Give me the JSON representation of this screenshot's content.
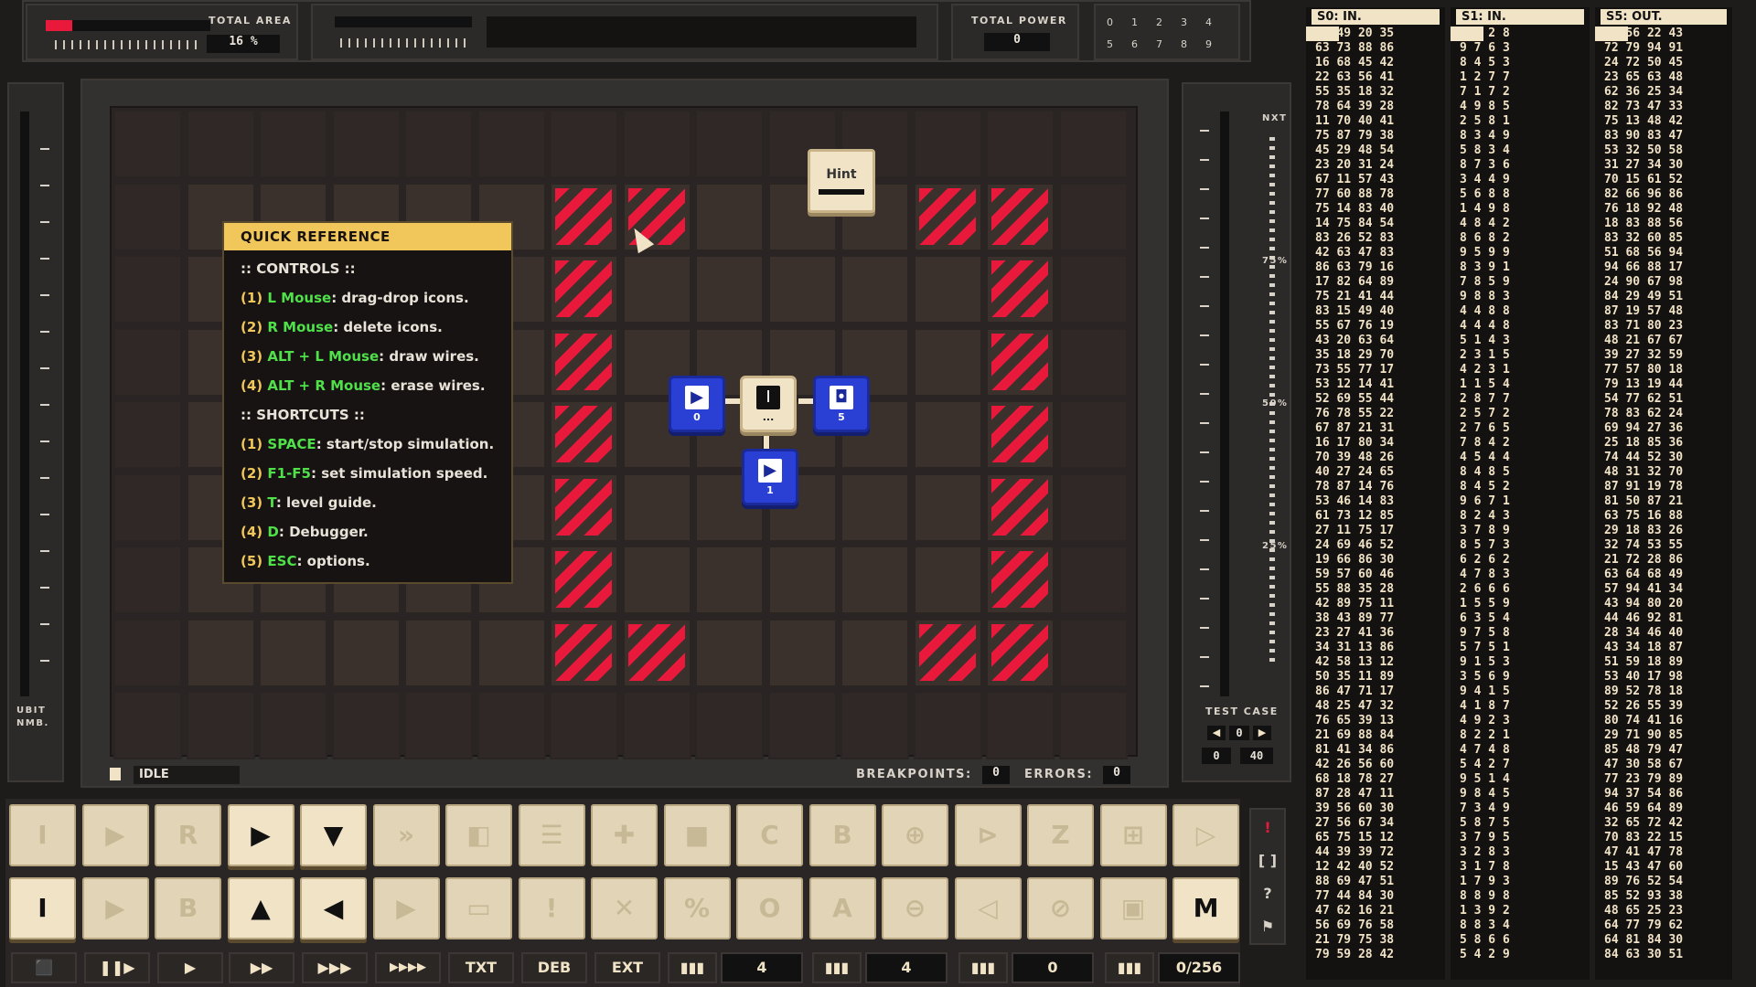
{
  "top_bar": {
    "total_area_label": "TOTAL AREA",
    "total_area_value": "16 %",
    "total_area_fraction": 0.16,
    "total_power_label": "TOTAL POWER",
    "total_power_value": "0",
    "digit_labels": [
      "0",
      "1",
      "2",
      "3",
      "4",
      "5",
      "6",
      "7",
      "8",
      "9"
    ]
  },
  "board": {
    "hint_label": "Hint",
    "blocks": [
      {
        "glyph": "▶",
        "number": "0"
      },
      {
        "glyph": "I",
        "number": "..."
      },
      {
        "glyph": "◘",
        "number": "5"
      },
      {
        "glyph": "▶",
        "number": "1"
      }
    ]
  },
  "quick_reference": {
    "title": "QUICK REFERENCE",
    "controls_header": ":: CONTROLS ::",
    "controls": [
      {
        "num": "(1)",
        "key": "L Mouse",
        "desc": ": drag-drop icons."
      },
      {
        "num": "(2)",
        "key": "R Mouse",
        "desc": ": delete icons."
      },
      {
        "num": "(3)",
        "key": "ALT + L Mouse",
        "desc": ": draw wires."
      },
      {
        "num": "(4)",
        "key": "ALT + R Mouse",
        "desc": ": erase wires."
      }
    ],
    "shortcuts_header": ":: SHORTCUTS ::",
    "shortcuts": [
      {
        "num": "(1)",
        "key": "SPACE",
        "desc": ": start/stop simulation."
      },
      {
        "num": "(2)",
        "key": "F1-F5",
        "desc": ": set simulation speed."
      },
      {
        "num": "(3)",
        "key": "T",
        "desc": ": level guide."
      },
      {
        "num": "(4)",
        "key": "D",
        "desc": ": Debugger."
      },
      {
        "num": "(5)",
        "key": "ESC",
        "desc": ": options."
      }
    ]
  },
  "status_bar": {
    "state": "IDLE",
    "breakpoints_label": "BREAKPOINTS:",
    "breakpoints_value": "0",
    "errors_label": "ERRORS:",
    "errors_value": "0"
  },
  "left_gauge": {
    "label_line1": "UBIT",
    "label_line2": "NMB."
  },
  "right_gauge": {
    "nxt_label": "NXT",
    "marks": [
      "75%",
      "50%",
      "25%"
    ],
    "test_case_label": "TEST CASE",
    "test_case_value": "0",
    "test_progress_current": "0",
    "test_progress_total": "40"
  },
  "io_columns": [
    {
      "title": "S0: IN.",
      "rows": [
        "60 49 20 35",
        "63 73 88 86",
        "16 68 45 42",
        "22 63 56 41",
        "55 35 18 32",
        "78 64 39 28",
        "11 70 40 41",
        "75 87 79 38",
        "45 29 48 54",
        "23 20 31 24",
        "67 11 57 43",
        "77 60 88 78",
        "75 14 83 40",
        "14 75 84 54",
        "83 26 52 83",
        "42 63 47 83",
        "86 63 79 16",
        "17 82 64 89",
        "75 21 41 44",
        "83 15 49 40",
        "55 67 76 19",
        "43 20 63 64",
        "35 18 29 70",
        "73 55 77 17",
        "53 12 14 41",
        "52 69 55 44",
        "76 78 55 22",
        "67 87 21 31",
        "16 17 80 34",
        "70 39 48 26",
        "40 27 24 65",
        "78 87 14 76",
        "53 46 14 83",
        "61 73 12 85",
        "27 11 75 17",
        "24 69 46 52",
        "19 66 86 30",
        "59 57 60 46",
        "55 88 35 28",
        "42 89 75 11",
        "38 43 89 77",
        "23 27 41 36",
        "34 31 13 86",
        "42 58 13 12",
        "50 35 11 89",
        "86 47 71 17",
        "48 25 47 32",
        "76 65 39 13",
        "21 69 88 84",
        "81 41 34 86",
        "42 26 56 60",
        "68 18 78 27",
        "87 28 47 11",
        "39 56 60 30",
        "27 56 67 34",
        "65 75 15 12",
        "44 39 39 72",
        "12 42 40 52",
        "88 69 47 51",
        "77 44 84 30",
        "47 62 16 21",
        "56 69 76 58",
        "21 79 75 38",
        "79 59 28 42"
      ]
    },
    {
      "title": "S1: IN.",
      "rows": [
        "7 7 2 8",
        "9 7 6 3",
        "8 4 5 3",
        "1 2 7 7",
        "7 1 7 2",
        "4 9 8 5",
        "2 5 8 1",
        "8 3 4 9",
        "5 8 3 4",
        "8 7 3 6",
        "3 4 4 9",
        "5 6 8 8",
        "1 4 9 8",
        "4 8 4 2",
        "8 6 8 2",
        "9 5 9 9",
        "8 3 9 1",
        "7 8 5 9",
        "9 8 8 3",
        "4 4 8 8",
        "4 4 4 8",
        "5 1 4 3",
        "2 3 1 5",
        "4 2 3 1",
        "1 1 5 4",
        "2 8 7 7",
        "2 5 7 2",
        "2 7 6 5",
        "7 8 4 2",
        "4 5 4 4",
        "8 4 8 5",
        "8 4 5 2",
        "9 6 7 1",
        "8 2 4 3",
        "3 7 8 9",
        "8 5 7 3",
        "6 2 6 2",
        "4 7 8 3",
        "2 6 6 6",
        "1 5 5 9",
        "6 3 5 4",
        "9 7 5 8",
        "5 7 5 1",
        "9 1 5 3",
        "3 5 6 9",
        "9 4 1 5",
        "4 1 8 7",
        "4 9 2 3",
        "8 2 2 1",
        "4 7 4 8",
        "5 4 2 7",
        "9 5 1 4",
        "9 8 4 5",
        "7 3 4 9",
        "5 8 7 5",
        "3 7 9 5",
        "3 2 8 3",
        "3 1 7 8",
        "1 7 9 3",
        "8 8 9 8",
        "1 3 9 2",
        "8 8 3 4",
        "5 8 6 6",
        "5 4 2 9"
      ]
    },
    {
      "title": "S5: OUT.",
      "rows": [
        "67 56 22 43",
        "72 79 94 91",
        "24 72 50 45",
        "23 65 63 48",
        "62 36 25 34",
        "82 73 47 33",
        "75 13 48 42",
        "83 90 83 47",
        "53 32 50 58",
        "31 27 34 30",
        "70 15 61 52",
        "82 66 96 86",
        "76 18 92 48",
        "18 83 88 56",
        "83 32 60 85",
        "51 68 56 94",
        "94 66 88 17",
        "24 90 67 98",
        "84 29 49 51",
        "87 19 57 48",
        "83 71 80 23",
        "48 21 67 67",
        "39 27 32 59",
        "77 57 80 18",
        "79 13 19 44",
        "54 77 62 51",
        "78 83 62 24",
        "69 94 27 36",
        "25 18 85 36",
        "74 44 52 30",
        "48 31 32 70",
        "87 91 19 78",
        "81 50 87 21",
        "63 75 16 88",
        "29 18 83 26",
        "32 74 53 55",
        "21 72 28 86",
        "63 64 68 49",
        "57 94 41 34",
        "43 94 80 20",
        "44 46 92 81",
        "28 34 46 40",
        "43 34 18 87",
        "51 59 18 89",
        "53 40 17 98",
        "89 52 78 18",
        "52 26 55 39",
        "80 74 41 16",
        "29 71 90 85",
        "85 48 79 47",
        "47 30 58 67",
        "77 23 79 89",
        "94 37 54 86",
        "46 59 64 89",
        "32 65 72 42",
        "70 83 22 15",
        "47 41 47 78",
        "15 43 47 60",
        "89 76 52 54",
        "85 52 93 38",
        "48 65 25 23",
        "64 77 79 62",
        "64 81 84 30",
        "84 63 30 51"
      ]
    }
  ],
  "palette": {
    "row1": [
      "I",
      "▶",
      "R",
      "▶",
      "▼",
      "»",
      "◧",
      "☰",
      "✚",
      "■",
      "C",
      "B",
      "⊕",
      "⊳",
      "Z",
      "⊞",
      "▷"
    ],
    "row2": [
      "I",
      "▶",
      "B",
      "▲",
      "◀",
      "▶",
      "▭",
      "!",
      "✕",
      "%",
      "O",
      "A",
      "⊖",
      "◁",
      "⊘",
      "▣",
      "M"
    ],
    "row1_active": [
      false,
      false,
      false,
      true,
      true,
      false,
      false,
      false,
      false,
      false,
      false,
      false,
      false,
      false,
      false,
      false,
      false
    ],
    "row2_active": [
      true,
      false,
      false,
      true,
      true,
      false,
      false,
      false,
      false,
      false,
      false,
      false,
      false,
      false,
      false,
      false,
      true
    ]
  },
  "side_tools": [
    "!",
    "[ ]",
    "?",
    "⚑"
  ],
  "bottom_controls": {
    "buttons": [
      "⬛",
      "❚❚▶",
      "▶",
      "▶▶",
      "▶▶▶",
      "▶▶▶▶",
      "TXT",
      "DEB",
      "EXT"
    ],
    "value1": "4",
    "value2": "4",
    "value3": "0",
    "value4": "0/256"
  }
}
